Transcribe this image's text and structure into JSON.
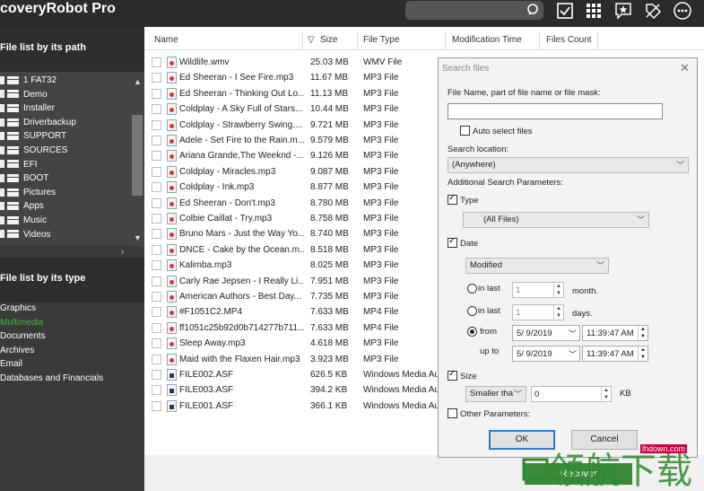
{
  "app": {
    "title": "coveryRobot Pro"
  },
  "toolbar": {
    "icons": [
      "search-icon",
      "select-check-icon",
      "grid-view-icon",
      "star-comment-icon",
      "tag-mark-icon",
      "more-options-icon"
    ]
  },
  "sidebar": {
    "path_header": "File list by its path",
    "tree": [
      "1 FAT32",
      "Demo",
      "Installer",
      "Driverbackup",
      "SUPPORT",
      "SOURCES",
      "EFI",
      "BOOT",
      "Pictures",
      "Apps",
      "Music",
      "Videos"
    ],
    "type_header": "File list by its type",
    "types": [
      {
        "label": "Graphics",
        "color": "#ffffff"
      },
      {
        "label": "Multimedia",
        "color": "#3cb83c"
      },
      {
        "label": "Documents",
        "color": "#ffffff"
      },
      {
        "label": "Archives",
        "color": "#ffffff"
      },
      {
        "label": "Email",
        "color": "#ffffff"
      },
      {
        "label": "Databases and Financials",
        "color": "#ffffff"
      }
    ]
  },
  "filelist": {
    "columns": [
      "Name",
      "Size",
      "File Type",
      "Modification Time",
      "Files Count"
    ],
    "rows": [
      {
        "name": "Wildlife.wmv",
        "size": "25.03 MB",
        "type": "WMV File",
        "icon": "media-file-icon"
      },
      {
        "name": "Ed Sheeran - I See Fire.mp3",
        "size": "11.67 MB",
        "type": "MP3 File",
        "icon": "media-file-icon"
      },
      {
        "name": "Ed Sheeran - Thinking Out Lo...",
        "size": "11.13 MB",
        "type": "MP3 File",
        "icon": "media-file-icon"
      },
      {
        "name": "Coldplay - A Sky Full of Stars...",
        "size": "10.44 MB",
        "type": "MP3 File",
        "icon": "media-file-icon"
      },
      {
        "name": "Coldplay - Strawberry Swing....",
        "size": "9.721 MB",
        "type": "MP3 File",
        "icon": "media-file-icon"
      },
      {
        "name": "Adele - Set Fire to the Rain.m...",
        "size": "9.579 MB",
        "type": "MP3 File",
        "icon": "media-file-icon"
      },
      {
        "name": "Ariana Grande,The Weeknd -...",
        "size": "9.126 MB",
        "type": "MP3 File",
        "icon": "media-file-icon"
      },
      {
        "name": "Coldplay - Miracles.mp3",
        "size": "9.087 MB",
        "type": "MP3 File",
        "icon": "media-file-icon"
      },
      {
        "name": "Coldplay - Ink.mp3",
        "size": "8.877 MB",
        "type": "MP3 File",
        "icon": "media-file-icon"
      },
      {
        "name": "Ed Sheeran - Don't.mp3",
        "size": "8.780 MB",
        "type": "MP3 File",
        "icon": "media-file-icon"
      },
      {
        "name": "Colbie Caillat - Try.mp3",
        "size": "8.758 MB",
        "type": "MP3 File",
        "icon": "media-file-icon"
      },
      {
        "name": "Bruno Mars - Just the Way Yo...",
        "size": "8.740 MB",
        "type": "MP3 File",
        "icon": "media-file-icon"
      },
      {
        "name": "DNCE - Cake by the Ocean.m...",
        "size": "8.518 MB",
        "type": "MP3 File",
        "icon": "media-file-icon"
      },
      {
        "name": "Kalimba.mp3",
        "size": "8.025 MB",
        "type": "MP3 File",
        "icon": "media-file-icon"
      },
      {
        "name": "Carly Rae Jepsen - I Really Li...",
        "size": "7.951 MB",
        "type": "MP3 File",
        "icon": "media-file-icon"
      },
      {
        "name": "American Authors - Best Day...",
        "size": "7.735 MB",
        "type": "MP3 File",
        "icon": "media-file-icon"
      },
      {
        "name": "#F1051C2.MP4",
        "size": "7.633 MB",
        "type": "MP4 File",
        "icon": "media-file-icon"
      },
      {
        "name": "ff1051c25b92d0b714277b711...",
        "size": "7.633 MB",
        "type": "MP4 File",
        "icon": "media-file-icon"
      },
      {
        "name": "Sleep Away.mp3",
        "size": "4.618 MB",
        "type": "MP3 File",
        "icon": "media-file-icon"
      },
      {
        "name": "Maid with the Flaxen Hair.mp3",
        "size": "3.923 MB",
        "type": "MP3 File",
        "icon": "media-file-icon"
      },
      {
        "name": "FILE002.ASF",
        "size": "626.5 KB",
        "type": "Windows Media Au",
        "icon": "asf-file-icon"
      },
      {
        "name": "FILE003.ASF",
        "size": "394.2 KB",
        "type": "Windows Media Au",
        "icon": "asf-file-icon"
      },
      {
        "name": "FILE001.ASF",
        "size": "366.1 KB",
        "type": "Windows Media Au",
        "icon": "asf-file-icon"
      }
    ],
    "recover_label": "Recover"
  },
  "dialog": {
    "title": "Search files",
    "close": "✕",
    "filename_label": "File Name, part of file name or file mask:",
    "filename_value": "",
    "auto_select_label": "Auto select files",
    "auto_select_checked": false,
    "location_label": "Search location:",
    "location_value": "(Anywhere)",
    "additional_label": "Additional Search Parameters:",
    "type_label": "Type",
    "type_checked": true,
    "type_value": "(All Files)",
    "date_label": "Date",
    "date_checked": true,
    "date_mode": "Modified",
    "in_last_label": "in last",
    "month_value": "1",
    "month_unit": "month.",
    "days_value": "1",
    "days_unit": "days.",
    "from_label": "from",
    "from_date": "5/ 9/2019",
    "from_time": "11:39:47 AM",
    "upto_label": "up to",
    "upto_date": "5/ 9/2019",
    "upto_time": "11:39:47 AM",
    "selected_range": "from",
    "size_label": "Size",
    "size_checked": true,
    "size_mode": "Smaller tha",
    "size_value": "0",
    "size_unit": "KB",
    "other_label": "Other Parameters:",
    "other_checked": false,
    "ok_label": "OK",
    "cancel_label": "Cancel"
  },
  "watermark": {
    "site": "lhdown.com",
    "text": "领航下载"
  }
}
